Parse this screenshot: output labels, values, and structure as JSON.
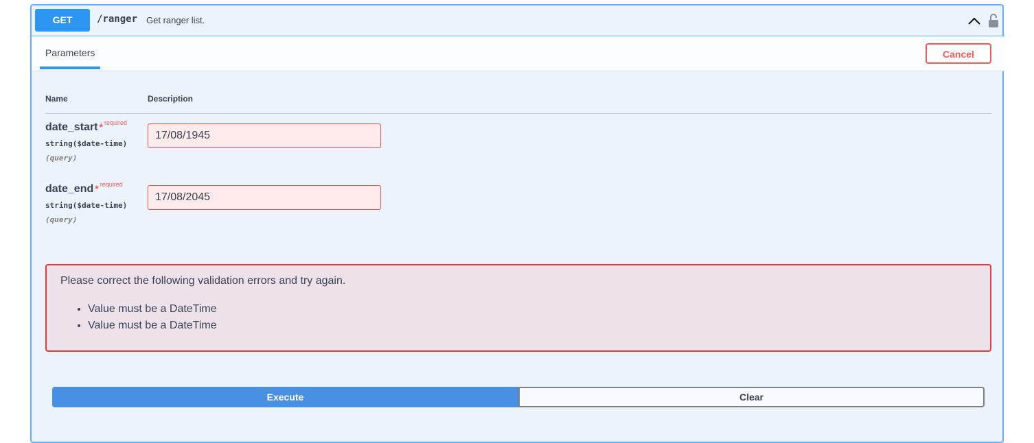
{
  "operation": {
    "method": "GET",
    "path": "/ranger",
    "summary": "Get ranger list.",
    "method_color": "#2c97f3",
    "icons": {
      "collapse": "chevron-up-icon",
      "lock": "unlocked-padlock-icon"
    }
  },
  "tabs": {
    "active_label": "Parameters",
    "cancel_label": "Cancel"
  },
  "table": {
    "name_header": "Name",
    "description_header": "Description"
  },
  "params": [
    {
      "name": "date_start",
      "required_star": "*",
      "required_label": "required",
      "type": "string($date-time)",
      "location": "(query)",
      "value": "17/08/1945"
    },
    {
      "name": "date_end",
      "required_star": "*",
      "required_label": "required",
      "type": "string($date-time)",
      "location": "(query)",
      "value": "17/08/2045"
    }
  ],
  "validation": {
    "message": "Please correct the following validation errors and try again.",
    "errors": [
      "Value must be a DateTime",
      "Value must be a DateTime"
    ],
    "border_color": "#e4393c"
  },
  "actions": {
    "execute_label": "Execute",
    "clear_label": "Clear",
    "execute_color": "#4990e2"
  }
}
